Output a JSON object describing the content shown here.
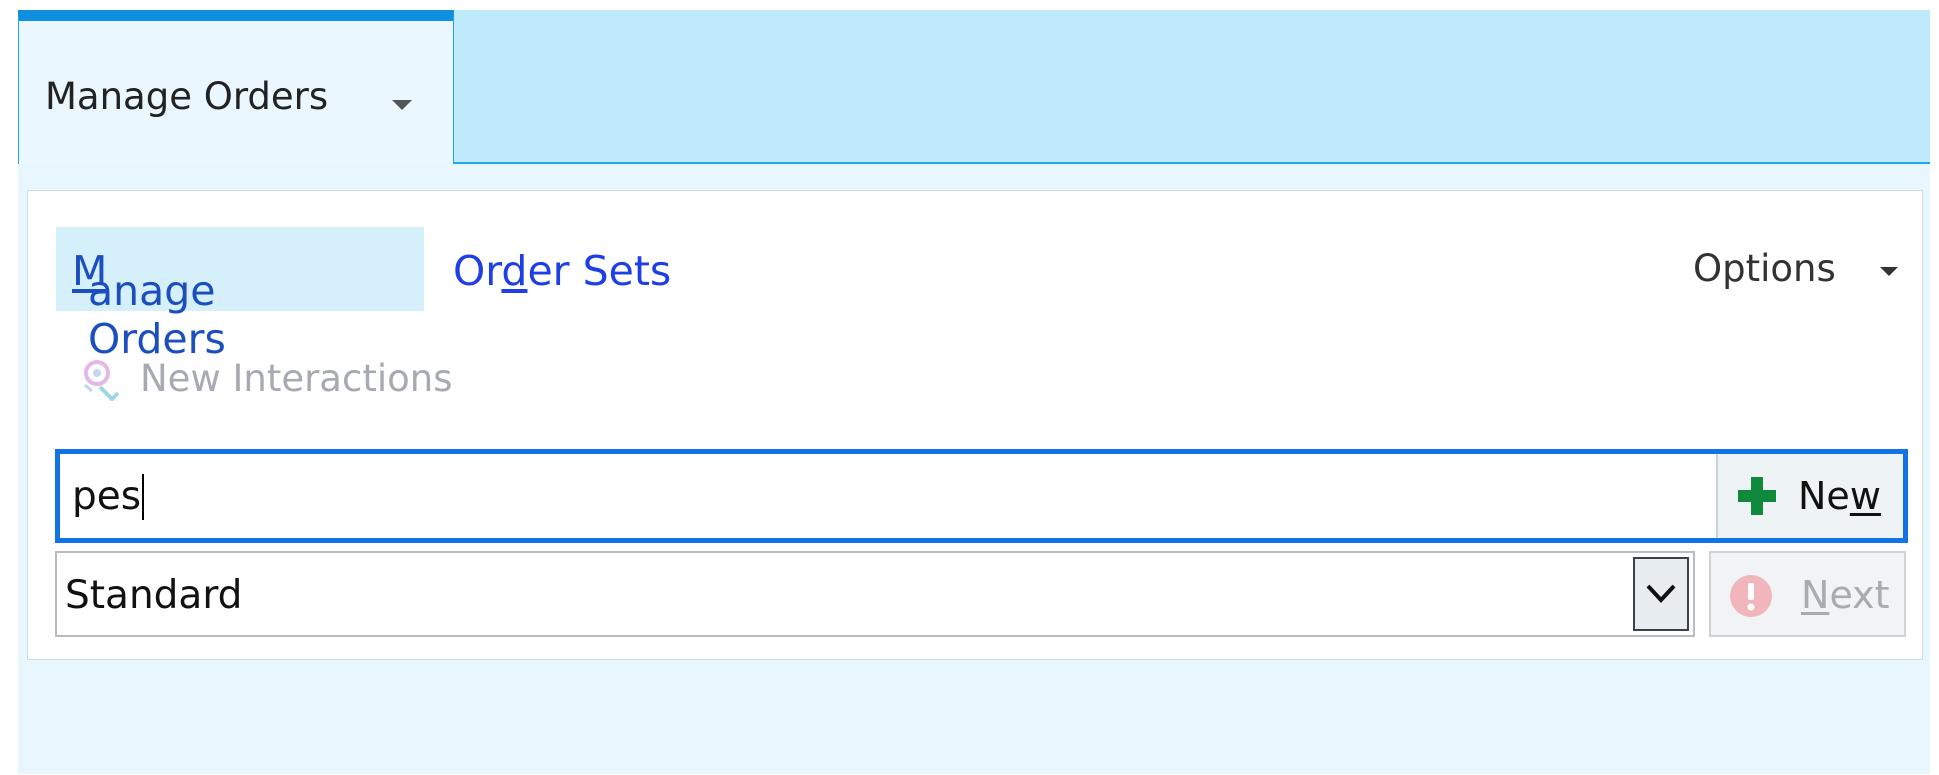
{
  "tab": {
    "label": "Manage Orders"
  },
  "subtabs": {
    "active": {
      "pre": "",
      "key": "M",
      "post": "anage Orders"
    },
    "other": {
      "pre": "Or",
      "key": "d",
      "post": "er Sets"
    }
  },
  "options_label": "Options",
  "interactions": {
    "label": "New Interactions",
    "icon": "interactions-icon"
  },
  "search": {
    "value": "pes",
    "placeholder": ""
  },
  "new_button": {
    "pre": "Ne",
    "key": "w",
    "post": "",
    "icon": "plus-icon"
  },
  "order_type": {
    "selected": "Standard"
  },
  "next_button": {
    "pre": "",
    "key": "N",
    "post": "ext",
    "icon": "warning-icon"
  },
  "colors": {
    "accent": "#1273e6",
    "tab_bar": "#bfeafc",
    "link": "#1f3fe6",
    "plus": "#0f8a3c",
    "warning": "#f1b6bc"
  }
}
